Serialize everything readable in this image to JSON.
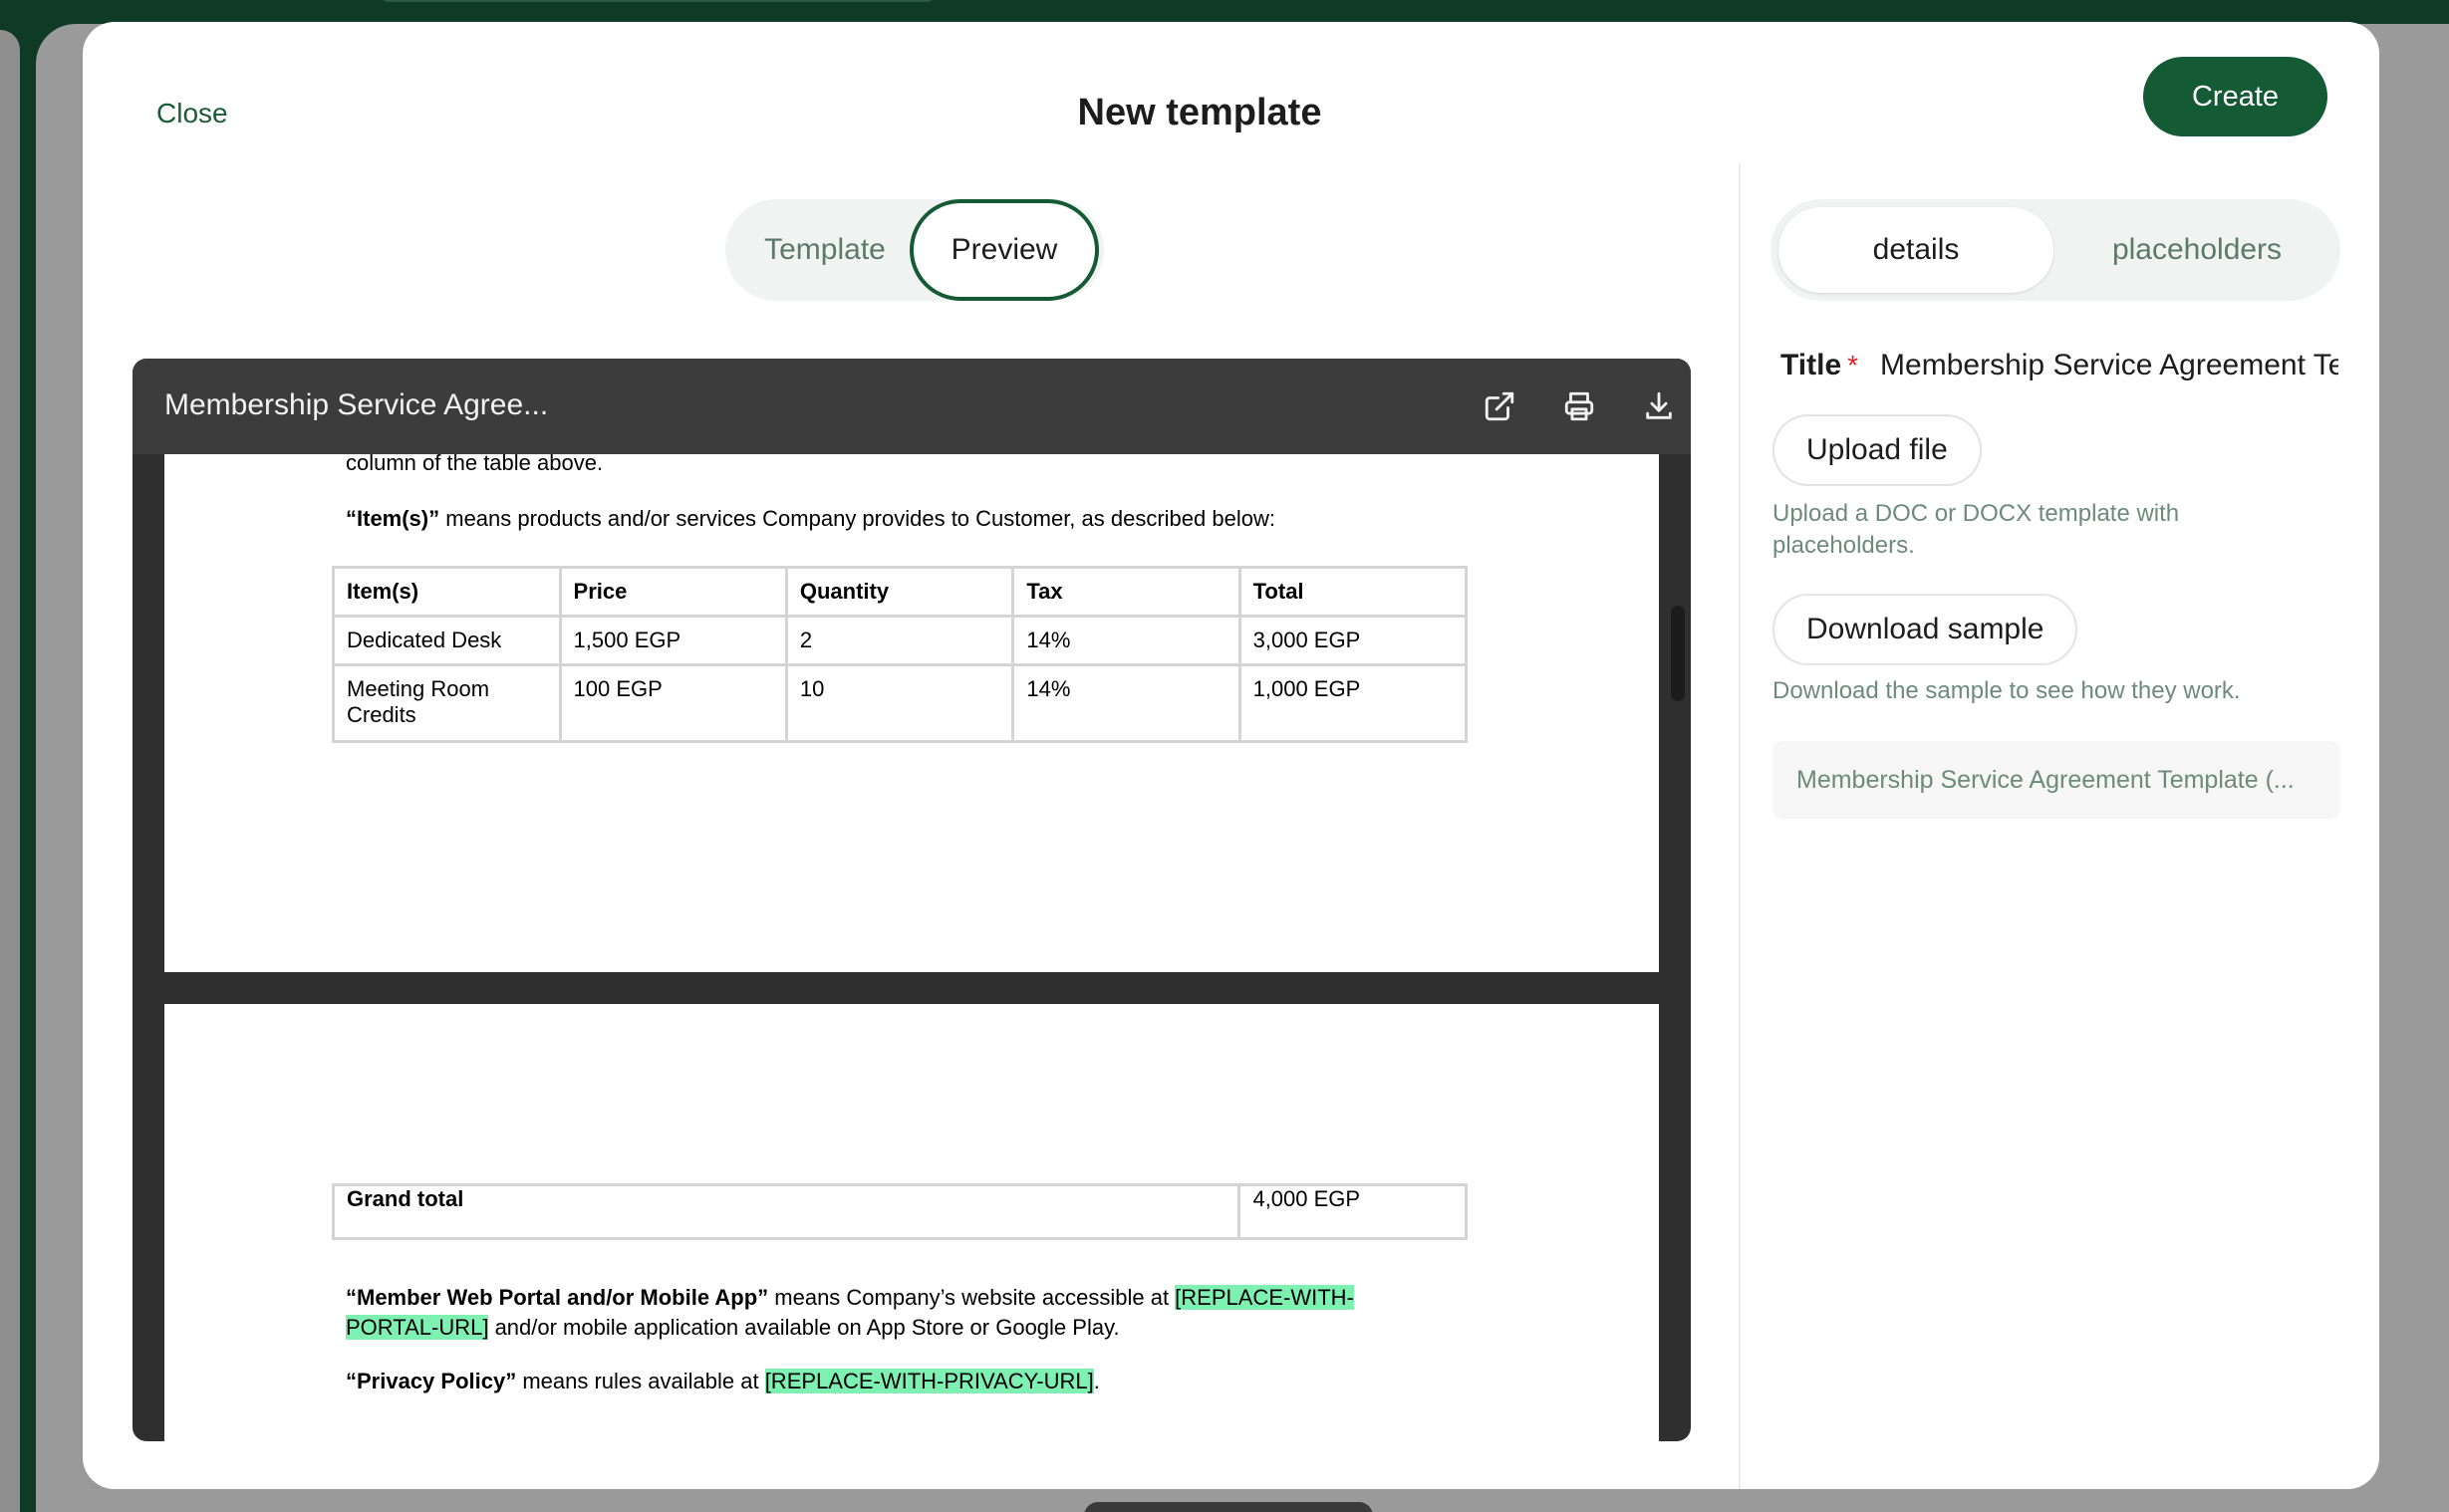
{
  "modal": {
    "close_label": "Close",
    "title": "New template",
    "create_label": "Create"
  },
  "view_toggle": {
    "template_label": "Template",
    "preview_label": "Preview",
    "selected": "Preview"
  },
  "viewer": {
    "doc_title": "Membership Service Agree...",
    "icons": [
      "external-link-icon",
      "print-icon",
      "download-icon"
    ],
    "page1": {
      "line_top": "column of the table above.",
      "items_term": "“Item(s)”",
      "items_def": " means products and/or services Company provides to Customer, as described below:",
      "table": {
        "headers": [
          "Item(s)",
          "Price",
          "Quantity",
          "Tax",
          "Total"
        ],
        "rows": [
          [
            "Dedicated Desk",
            "1,500 EGP",
            "2",
            "14%",
            "3,000 EGP"
          ],
          [
            "Meeting Room Credits",
            "100 EGP",
            "10",
            "14%",
            "1,000 EGP"
          ]
        ]
      }
    },
    "page2": {
      "grand_total_label": "Grand total",
      "grand_total_value": "4,000 EGP",
      "portal_term": "“Member Web Portal and/or Mobile App”",
      "portal_def_1": " means Company’s website accessible at ",
      "portal_placeholder_1": "[REPLACE-WITH-",
      "portal_placeholder_2": "PORTAL-URL]",
      "portal_def_2": " and/or mobile application available on App Store or Google Play.",
      "privacy_term": "“Privacy Policy”",
      "privacy_def": " means rules available at ",
      "privacy_placeholder": "[REPLACE-WITH-PRIVACY-URL]",
      "privacy_end": "."
    }
  },
  "side_panel": {
    "tabs": {
      "details_label": "details",
      "placeholders_label": "placeholders",
      "selected": "details"
    },
    "title_label": "Title",
    "required_mark": "*",
    "title_value": "Membership Service Agreement Template",
    "upload_label": "Upload file",
    "upload_help": "Upload a DOC or DOCX template with placeholders.",
    "download_label": "Download sample",
    "download_help": "Download the sample to see how they work.",
    "file_name": "Membership Service Agreement Template (..."
  },
  "colors": {
    "brand": "#135a35",
    "highlight": "#7ef0b2",
    "muted_text": "#6d8a7c"
  }
}
